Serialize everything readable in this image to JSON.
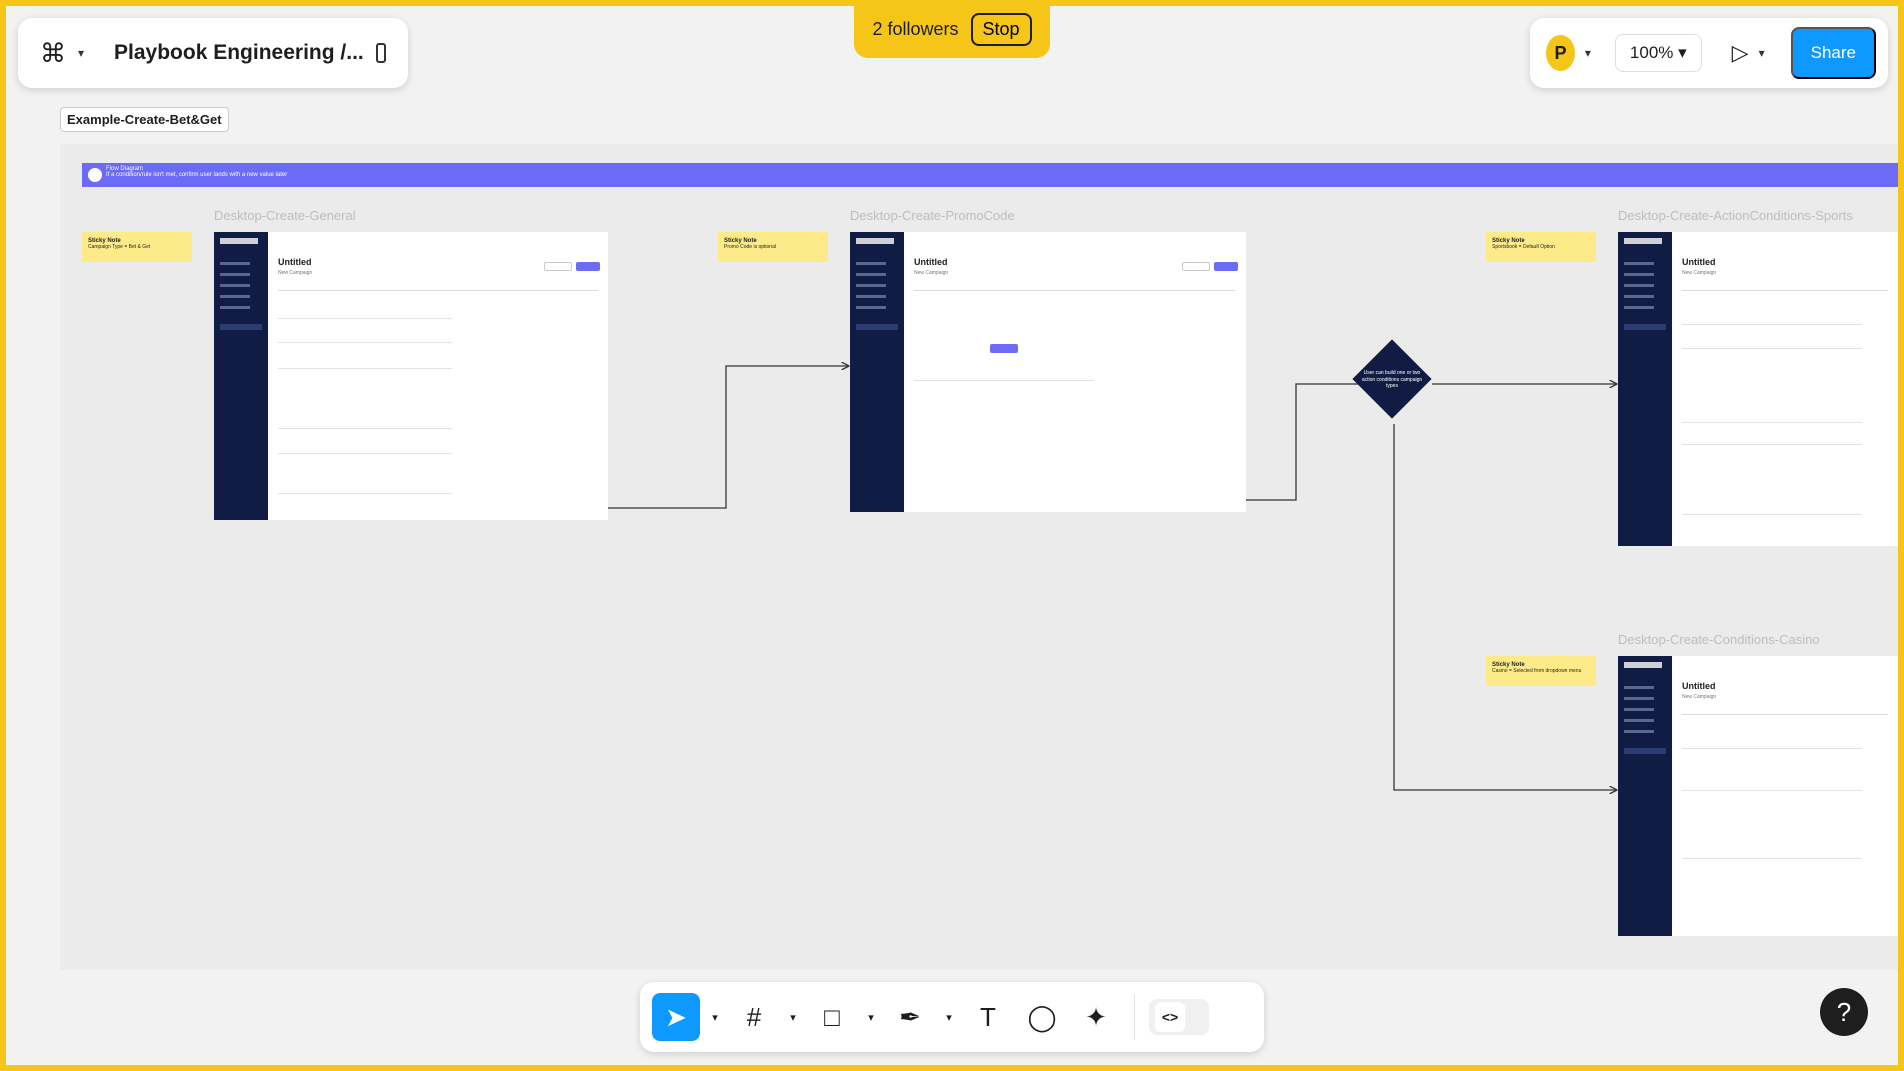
{
  "header": {
    "document_title": "Playbook Engineering /...",
    "figma_menu_icon": "figma-logo-icon",
    "sidebar_toggle_icon": "sidebar-toggle-icon"
  },
  "follow_bar": {
    "followers_text": "2 followers",
    "stop_label": "Stop"
  },
  "right_panel": {
    "avatar_initial": "P",
    "zoom_level": "100%",
    "present_icon": "play-icon",
    "share_label": "Share"
  },
  "canvas": {
    "frame_label": "Example-Create-Bet&Get",
    "banner_title": "Flow Diagram",
    "banner_subtitle": "If a condition/rule isn't met, confirm user lands with a new value later",
    "screens": [
      {
        "label": "Desktop-Create-General",
        "title": "Untitled",
        "subtitle": "New Campaign"
      },
      {
        "label": "Desktop-Create-PromoCode",
        "title": "Untitled",
        "subtitle": "New Campaign"
      },
      {
        "label": "Desktop-Create-ActionConditions-Sports",
        "title": "Untitled",
        "subtitle": "New Campaign"
      },
      {
        "label": "Desktop-Create-Conditions-Casino",
        "title": "Untitled",
        "subtitle": "New Campaign"
      }
    ],
    "stickies": [
      {
        "title": "Sticky Note",
        "body": "Campaign Type = Bet & Get"
      },
      {
        "title": "Sticky Note",
        "body": "Promo Code is optional"
      },
      {
        "title": "Sticky Note",
        "body": "Sportsbook = Default Option"
      },
      {
        "title": "Sticky Note",
        "body": "Casino = Selected from dropdown menu"
      }
    ],
    "decision_text": "User can build one or two action conditions campaign types"
  },
  "toolbar": {
    "tools": [
      {
        "name": "move-tool",
        "icon": "cursor-icon",
        "glyph": "➤"
      },
      {
        "name": "frame-tool",
        "icon": "frame-icon",
        "glyph": "#"
      },
      {
        "name": "shape-tool",
        "icon": "rectangle-icon",
        "glyph": "□"
      },
      {
        "name": "pen-tool",
        "icon": "pen-icon",
        "glyph": "✒"
      },
      {
        "name": "text-tool",
        "icon": "text-icon",
        "glyph": "T"
      },
      {
        "name": "comment-tool",
        "icon": "comment-icon",
        "glyph": "◯"
      },
      {
        "name": "ai-tool",
        "icon": "sparkle-icon",
        "glyph": "✦"
      }
    ],
    "dev_mode_glyph": "<>"
  },
  "help_glyph": "?",
  "colors": {
    "follow_border": "#f5c518",
    "share_button": "#0d99ff",
    "banner": "#6b6bf5",
    "sidebar_navy": "#111c44",
    "sticky": "#fdeb8a"
  }
}
